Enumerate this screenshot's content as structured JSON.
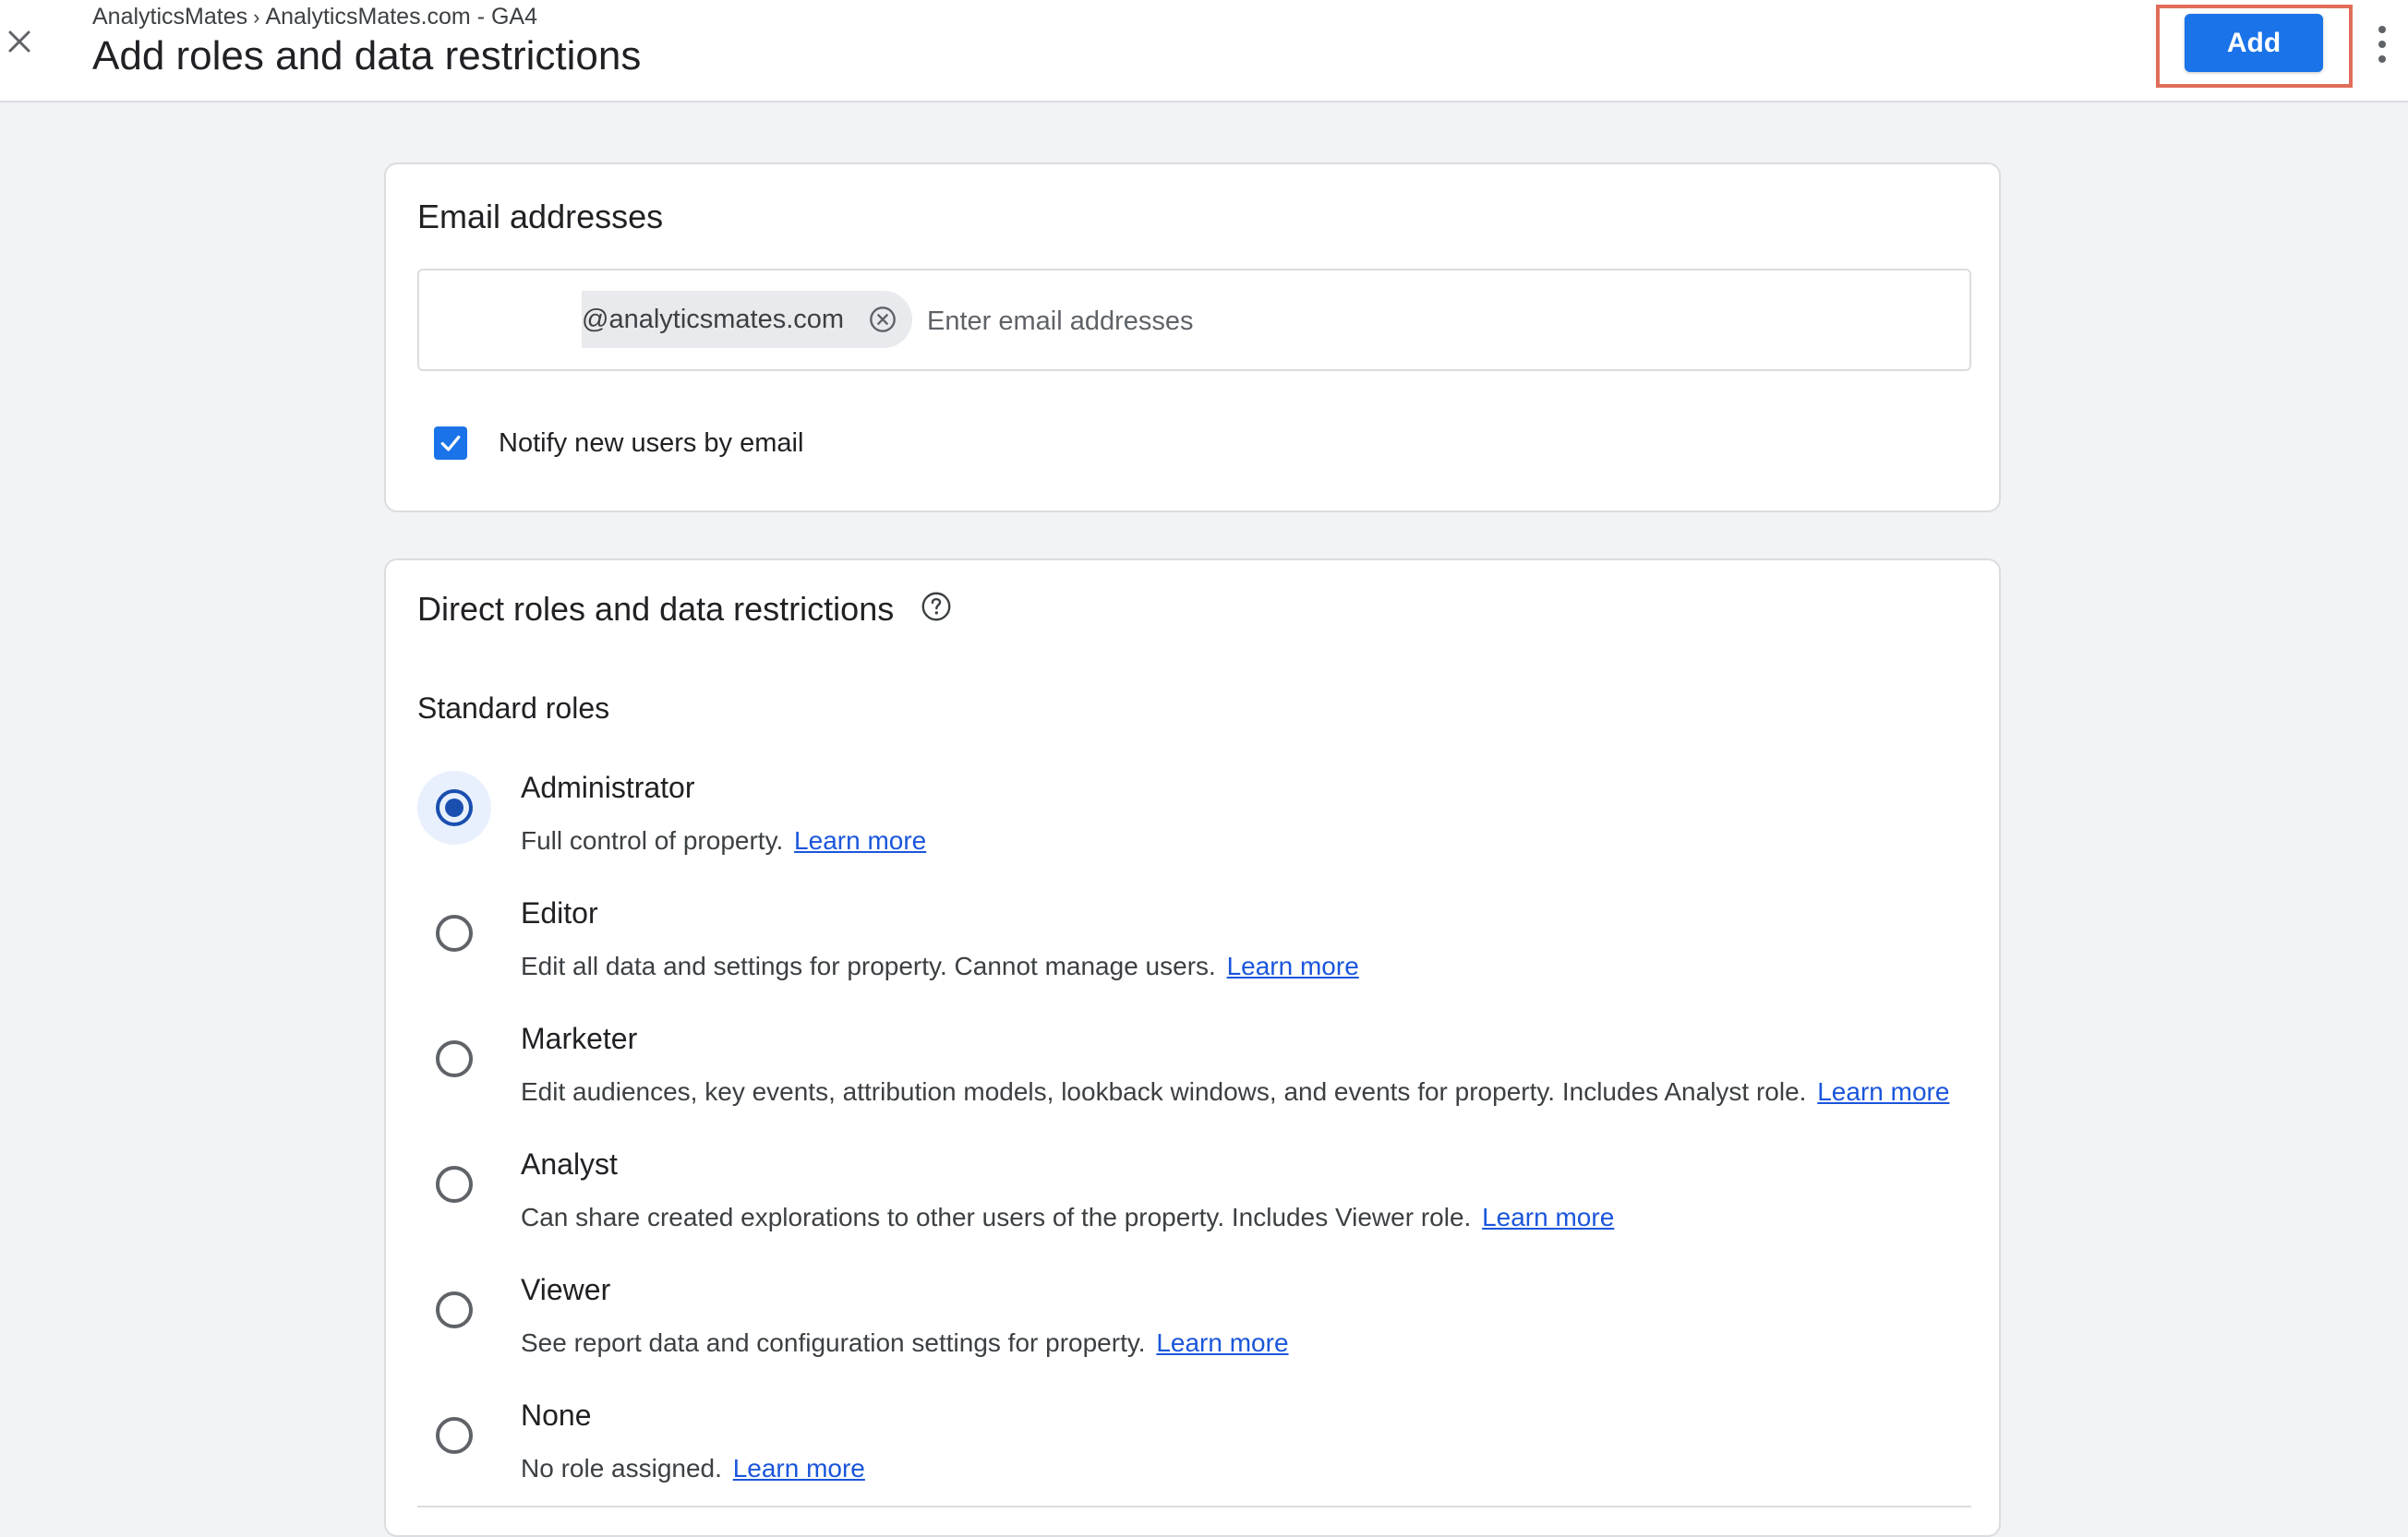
{
  "header": {
    "breadcrumb": [
      "AnalyticsMates",
      "AnalyticsMates.com - GA4"
    ],
    "breadcrumb_separator": "›",
    "title": "Add roles and data restrictions",
    "add_label": "Add",
    "close_icon": "close-icon",
    "more_icon": "more-vert-icon"
  },
  "email_card": {
    "title": "Email addresses",
    "chip_text": "@analyticsmates.com",
    "input_placeholder": "Enter email addresses",
    "input_value": "",
    "notify_label": "Notify new users by email",
    "notify_checked": true
  },
  "roles_card": {
    "title": "Direct roles and data restrictions",
    "standard_roles_label": "Standard roles",
    "learn_more": "Learn more",
    "selected": "Administrator",
    "roles": [
      {
        "name": "Administrator",
        "desc": "Full control of property."
      },
      {
        "name": "Editor",
        "desc": "Edit all data and settings for property. Cannot manage users."
      },
      {
        "name": "Marketer",
        "desc": "Edit audiences, key events, attribution models, lookback windows, and events for property. Includes Analyst role."
      },
      {
        "name": "Analyst",
        "desc": "Can share created explorations to other users of the property. Includes Viewer role."
      },
      {
        "name": "Viewer",
        "desc": "See report data and configuration settings for property."
      },
      {
        "name": "None",
        "desc": "No role assigned."
      }
    ]
  },
  "colors": {
    "accent": "#1a73e8",
    "highlight_border": "#e06c5a",
    "radio_selected": "#1a4fb0",
    "link": "#1a56db"
  }
}
